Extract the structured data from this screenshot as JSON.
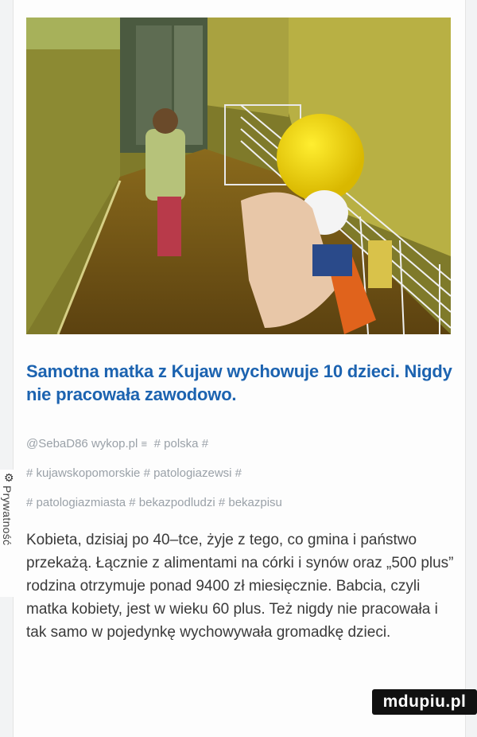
{
  "article": {
    "title": "Samotna matka z Kujaw wychowuje 10 dzieci. Nigdy nie pracowała zawodowo.",
    "meta": {
      "author": "@SebaD86",
      "source": "wykop.pl",
      "list_icon": "list-icon",
      "tags": [
        "# polska",
        "# kujawskopomorskie",
        "# patologiazewsi",
        "# patologiazmiasta",
        "# bekazpodludzi",
        "# bekazpisu"
      ]
    },
    "body": "Kobieta, dzisiaj po 40–tce, żyje z tego, co gmina i państwo przekażą. Łącznie z alimentami na córki i synów oraz „500 plus” rodzina otrzymuje ponad 9400 zł miesięcznie. Babcia, czyli matka kobiety, jest w wieku 60 plus. Też nigdy nie pracowała i tak samo w pojedynkę wychowywała gromadkę dzieci."
  },
  "side_tab": {
    "icon": "gear-icon",
    "label": "Prywatność"
  },
  "watermark": "mdupiu.pl",
  "colors": {
    "title": "#1c63b0",
    "meta": "#9aa1a8",
    "text": "#3a3a3a"
  }
}
